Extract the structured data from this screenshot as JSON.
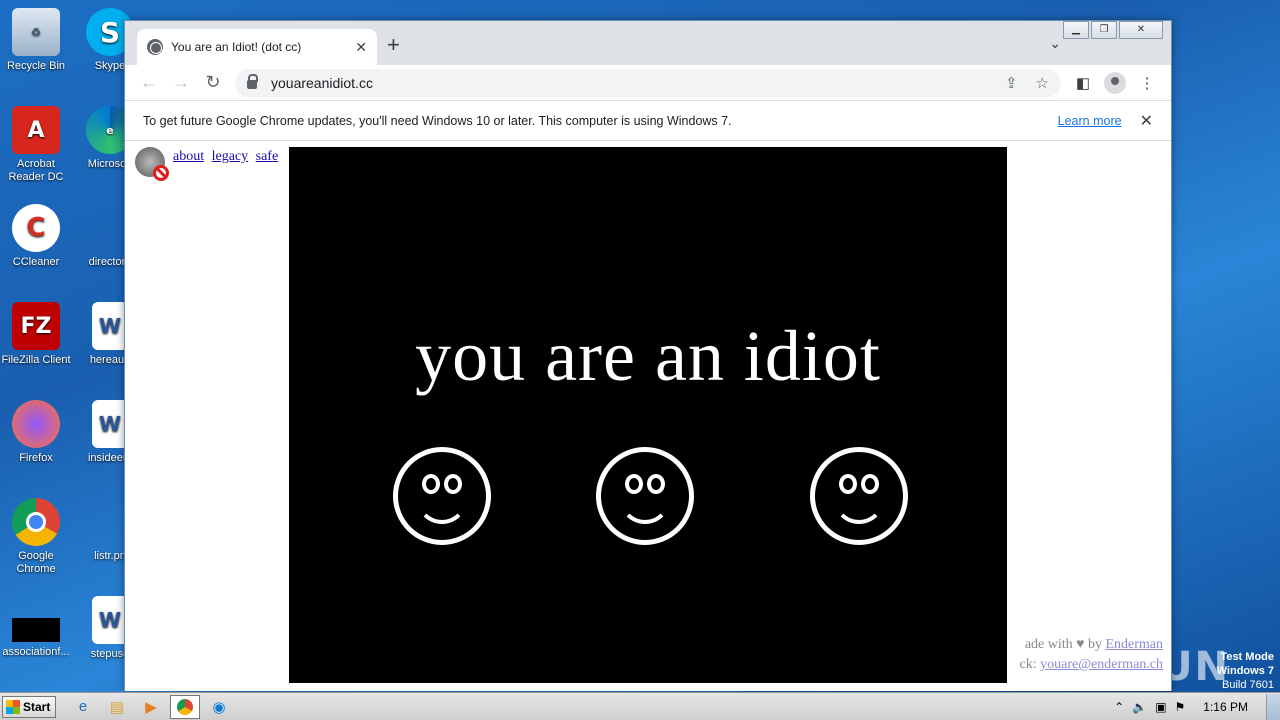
{
  "desktop": {
    "icons": [
      {
        "label": "Recycle Bin",
        "icon": "recycle-bin-icon"
      },
      {
        "label": "Skype",
        "icon": "skype-icon"
      },
      {
        "label": "Acrobat Reader DC",
        "icon": "acrobat-icon"
      },
      {
        "label": "Microsoft",
        "icon": "edge-icon"
      },
      {
        "label": "CCleaner",
        "icon": "ccleaner-icon"
      },
      {
        "label": "directorn",
        "icon": "blank-file-icon"
      },
      {
        "label": "FileZilla Client",
        "icon": "filezilla-icon"
      },
      {
        "label": "hereaug",
        "icon": "word-doc-icon"
      },
      {
        "label": "Firefox",
        "icon": "firefox-icon"
      },
      {
        "label": "insideent",
        "icon": "word-doc-icon"
      },
      {
        "label": "Google Chrome",
        "icon": "chrome-icon"
      },
      {
        "label": "listr.pn",
        "icon": "blank-file-icon"
      },
      {
        "label": "associationf...",
        "icon": "black-file-icon"
      },
      {
        "label": "stepuse",
        "icon": "word-doc-icon"
      }
    ],
    "watermark": "ANY RUN",
    "test_mode": {
      "line1": "Test Mode",
      "line2": "Windows 7",
      "line3": "Build 7601"
    }
  },
  "browser": {
    "tab_title": "You are an Idiot! (dot cc)",
    "url": "youareanidiot.cc",
    "infobar": {
      "message": "To get future Google Chrome updates, you'll need Windows 10 or later. This computer is using Windows 7.",
      "link": "Learn more"
    }
  },
  "page": {
    "links": [
      "about",
      "legacy",
      "safe"
    ],
    "headline": "you are an idiot",
    "footer_line1_prefix": "ade with",
    "footer_line1_by": "by",
    "footer_line1_link": "Enderman",
    "footer_line2_prefix": "ck:",
    "footer_line2_link": "youare@enderman.ch"
  },
  "taskbar": {
    "start_label": "Start",
    "clock": "1:16 PM"
  }
}
